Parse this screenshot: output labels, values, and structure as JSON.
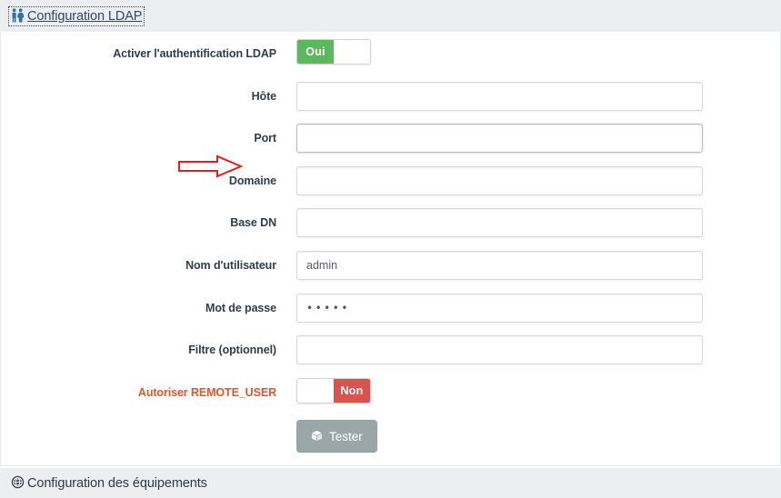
{
  "panels": {
    "ldap": {
      "title": "Configuration LDAP",
      "icon": "male-female-icon",
      "focused": true
    },
    "equipments": {
      "title": "Configuration des équipements",
      "icon": "globe-icon"
    }
  },
  "form": {
    "rows": [
      {
        "label": "Activer l'authentification LDAP",
        "name": "enable-ldap",
        "type": "toggle",
        "state": "on",
        "on_label": "Oui",
        "off_label": ""
      },
      {
        "label": "Hôte",
        "name": "host",
        "type": "text",
        "value": "",
        "placeholder": ""
      },
      {
        "label": "Port",
        "name": "port",
        "type": "text",
        "value": "",
        "placeholder": "",
        "highlighted": true
      },
      {
        "label": "Domaine",
        "name": "domain",
        "type": "text",
        "value": "",
        "placeholder": ""
      },
      {
        "label": "Base DN",
        "name": "base-dn",
        "type": "text",
        "value": "",
        "placeholder": ""
      },
      {
        "label": "Nom d'utilisateur",
        "name": "username",
        "type": "text",
        "value": "admin",
        "placeholder": ""
      },
      {
        "label": "Mot de passe",
        "name": "password",
        "type": "password",
        "masked_value": "•••••",
        "char_count": 5
      },
      {
        "label": "Filtre (optionnel)",
        "name": "filter",
        "type": "text",
        "value": "",
        "placeholder": ""
      },
      {
        "label": "Autoriser REMOTE_USER",
        "name": "allow-remote-user",
        "type": "toggle",
        "state": "off",
        "on_label": "",
        "off_label": "Non",
        "label_danger": true
      }
    ],
    "test_button": {
      "label": "Tester",
      "icon": "cube-icon"
    }
  },
  "annotation": {
    "type": "arrow",
    "direction": "right",
    "points_to": "Port",
    "color": "#e02020"
  },
  "colors": {
    "toggle_on": "#5cb85c",
    "toggle_off": "#d9534f",
    "label": "#2c3e50",
    "label_danger": "#e8502e",
    "header_bg": "#eceef0",
    "button_bg": "#9aa7a8",
    "annotation": "#e02020"
  }
}
